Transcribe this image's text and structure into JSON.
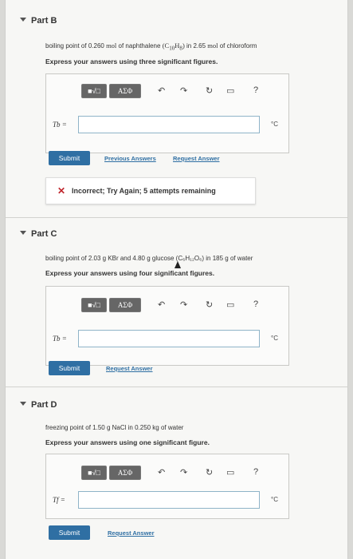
{
  "partB": {
    "title": "Part B",
    "question_prefix": "boiling point of 0.260 ",
    "question_mol1": "mol",
    "question_mid": " of naphthalene ",
    "question_formula": "(C",
    "q_sub1": "10",
    "q_mid2": "H",
    "q_sub2": "8",
    "q_close": ")",
    "question_tail": " in 2.65 ",
    "question_mol2": "mol",
    "question_end": " of chloroform",
    "instruction": "Express your answers using three significant figures.",
    "toolbar_math": "■√□",
    "toolbar_greek": "ΑΣΦ",
    "answer_label": "Tb =",
    "answer_value": "",
    "unit": "°C",
    "submit_label": "Submit",
    "prev_answers": "Previous Answers",
    "request_answer": "Request Answer",
    "feedback_text": "Incorrect; Try Again; 5 attempts remaining"
  },
  "partC": {
    "title": "Part C",
    "question": "boiling point of 2.03 g KBr and 4.80 g glucose (C₆H₁₂O₆) in 185 g of water",
    "instruction": "Express your answers using four significant figures.",
    "toolbar_math": "■√□",
    "toolbar_greek": "ΑΣΦ",
    "answer_label": "Tb =",
    "answer_value": "",
    "unit": "°C",
    "submit_label": "Submit",
    "request_answer": "Request Answer"
  },
  "partD": {
    "title": "Part D",
    "question": "freezing point of 1.50 g NaCl in 0.250 kg of water",
    "instruction": "Express your answers using one significant figure.",
    "toolbar_math": "■√□",
    "toolbar_greek": "ΑΣΦ",
    "answer_label": "Tf =",
    "answer_value": "",
    "unit": "°C",
    "submit_label": "Submit",
    "request_answer": "Request Answer"
  },
  "icons": {
    "undo": "↶",
    "redo": "↷",
    "reset": "↻",
    "keyboard": "▭",
    "help": "?",
    "incorrect": "✕"
  }
}
